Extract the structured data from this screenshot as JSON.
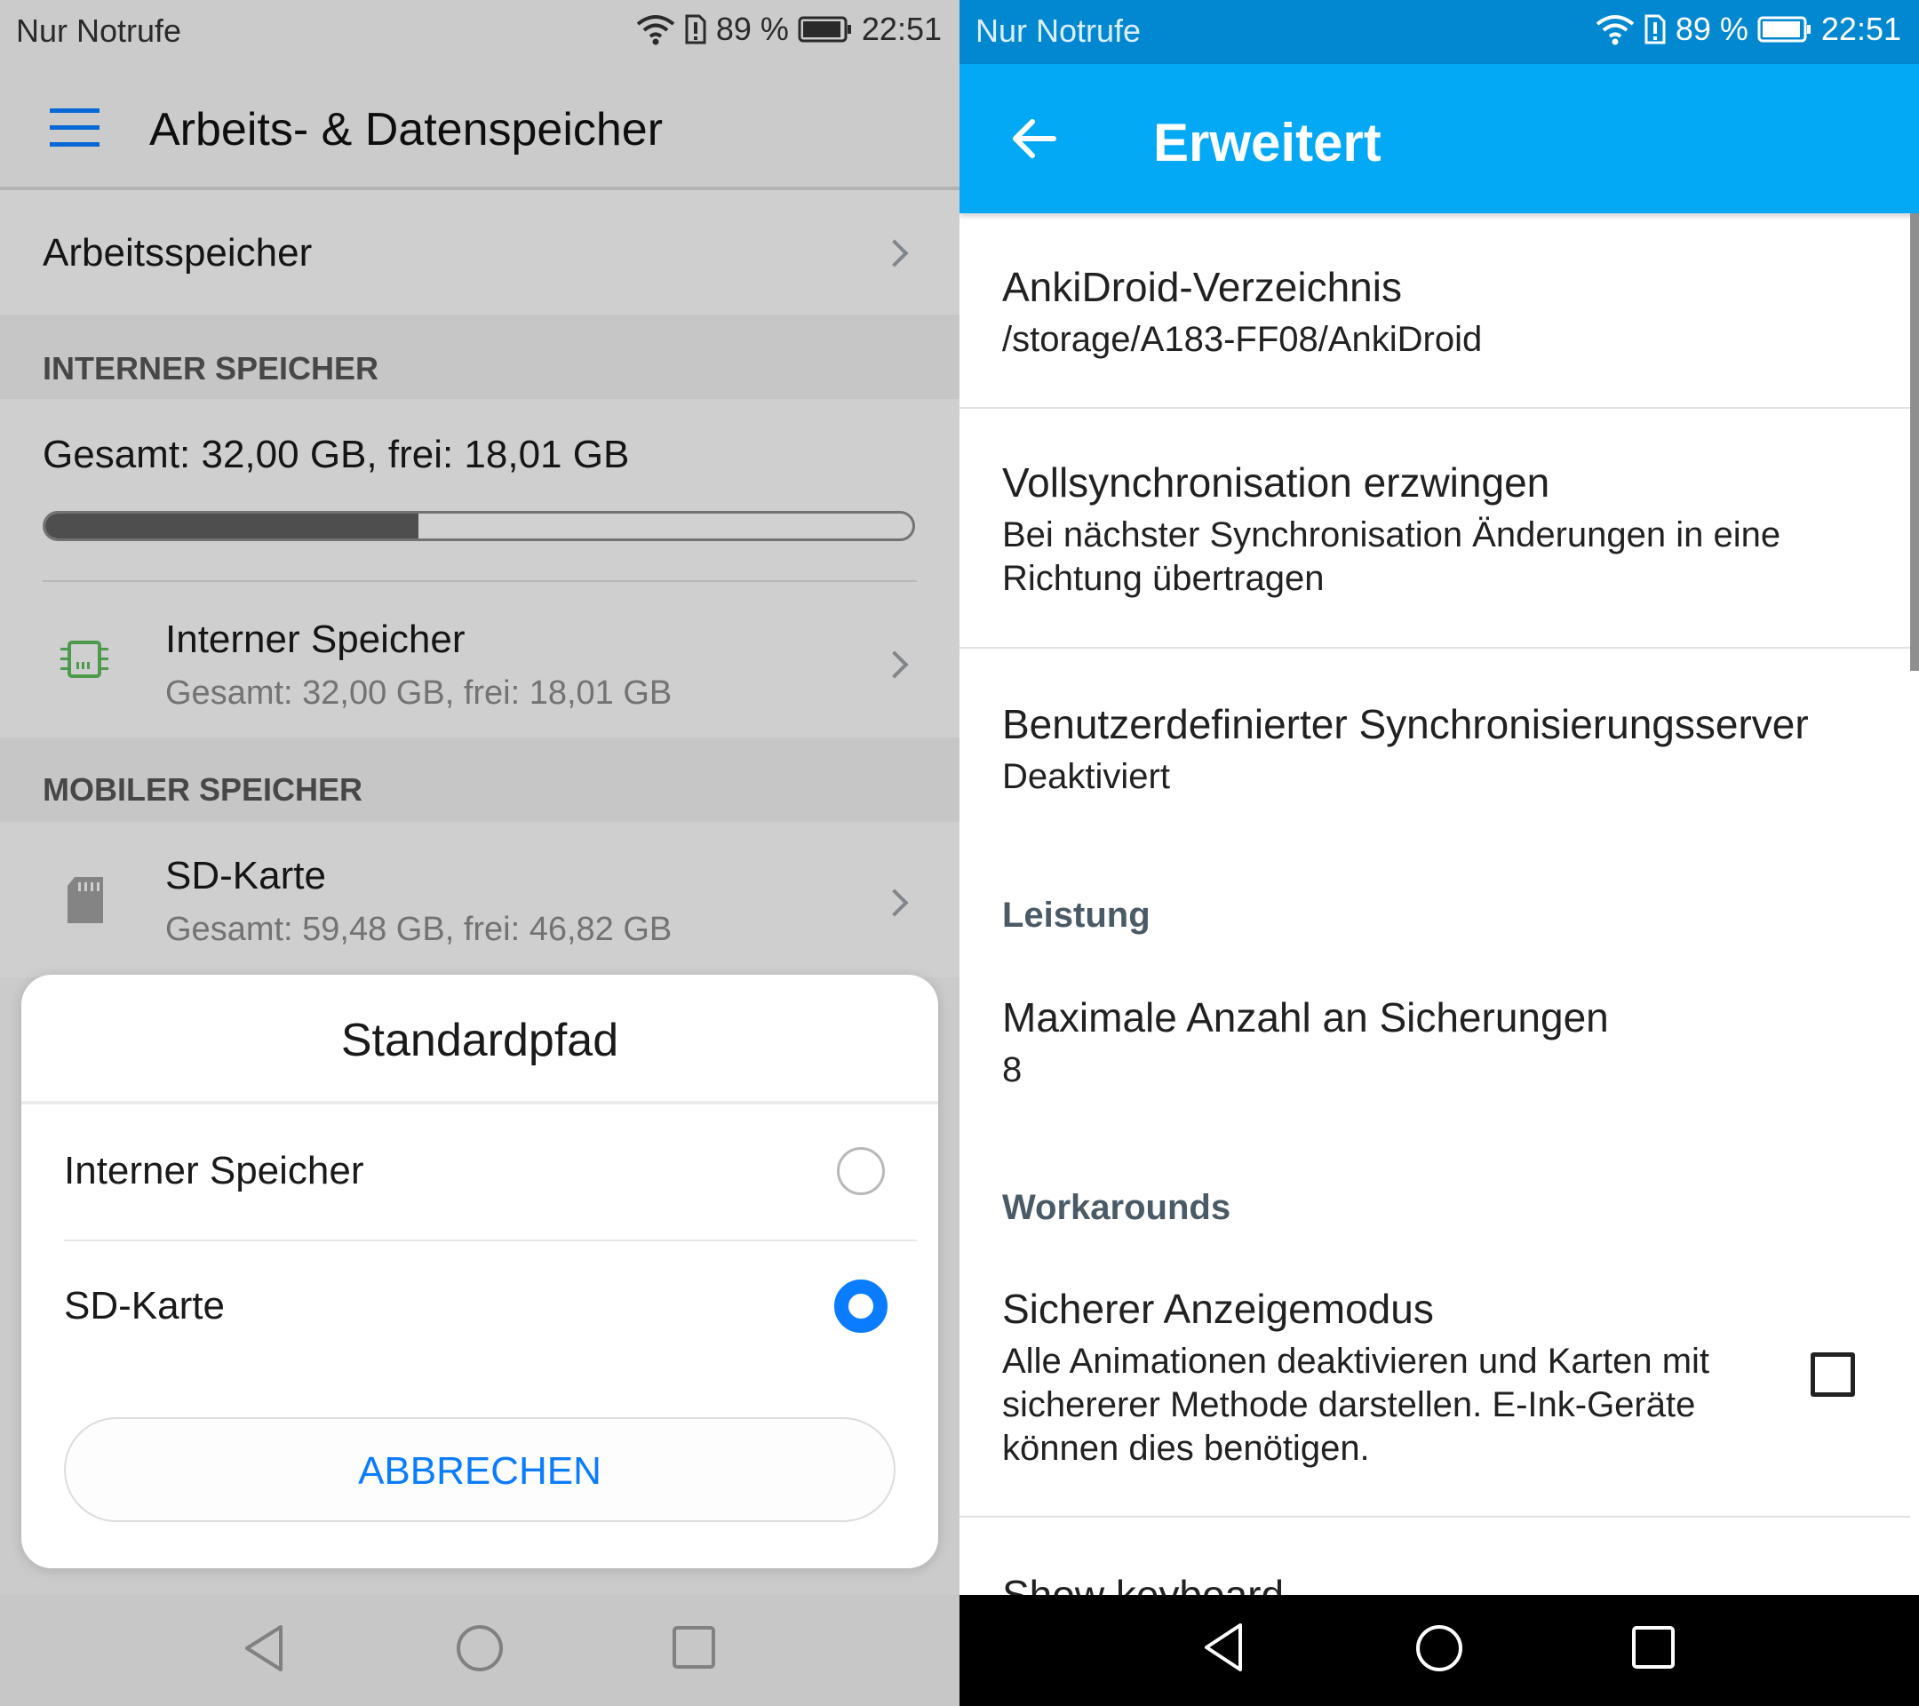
{
  "left": {
    "status": {
      "carrier": "Nur Notrufe",
      "battery": "89 %",
      "time": "22:51"
    },
    "header": {
      "title": "Arbeits- & Datenspeicher"
    },
    "ram_item": {
      "label": "Arbeitsspeicher"
    },
    "internal_section": {
      "header": "INTERNER SPEICHER",
      "summary": "Gesamt: 32,00 GB, frei: 18,01 GB",
      "usage_fraction": 0.43,
      "item_title": "Interner Speicher",
      "item_sub": "Gesamt: 32,00 GB, frei: 18,01 GB"
    },
    "mobile_section": {
      "header": "MOBILER SPEICHER",
      "item_title": "SD-Karte",
      "item_sub": "Gesamt: 59,48 GB, frei: 46,82 GB"
    },
    "dialog": {
      "title": "Standardpfad",
      "options": [
        {
          "label": "Interner Speicher",
          "selected": false
        },
        {
          "label": "SD-Karte",
          "selected": true
        }
      ],
      "cancel_label": "ABBRECHEN"
    }
  },
  "right": {
    "status": {
      "carrier": "Nur Notrufe",
      "battery": "89 %",
      "time": "22:51"
    },
    "appbar": {
      "title": "Erweitert"
    },
    "prefs": {
      "directory": {
        "title": "AnkiDroid-Verzeichnis",
        "summary": "/storage/A183-FF08/AnkiDroid"
      },
      "full_sync": {
        "title": "Vollsynchronisation erzwingen",
        "summary_line1": "Bei nächster Synchronisation Änderungen in eine",
        "summary_line2": "Richtung übertragen"
      },
      "custom_server": {
        "title": "Benutzerdefinierter Synchronisierungsserver",
        "summary": "Deaktiviert"
      },
      "category_performance": "Leistung",
      "max_backups": {
        "title": "Maximale Anzahl an Sicherungen",
        "summary": "8"
      },
      "category_workarounds": "Workarounds",
      "safe_display": {
        "title": "Sicherer Anzeigemodus",
        "line1": "Alle Animationen deaktivieren und Karten mit",
        "line2": "sichererer Methode darstellen. E-Ink-Geräte",
        "line3": "können dies benötigen.",
        "checked": false
      },
      "show_keyboard": {
        "title": "Show keyboard"
      }
    }
  },
  "colors": {
    "accent_blue": "#0a7cff",
    "appbar_blue": "#03a9f4",
    "statusbar_blue": "#0288d1",
    "category_gray": "#4a5a66"
  }
}
